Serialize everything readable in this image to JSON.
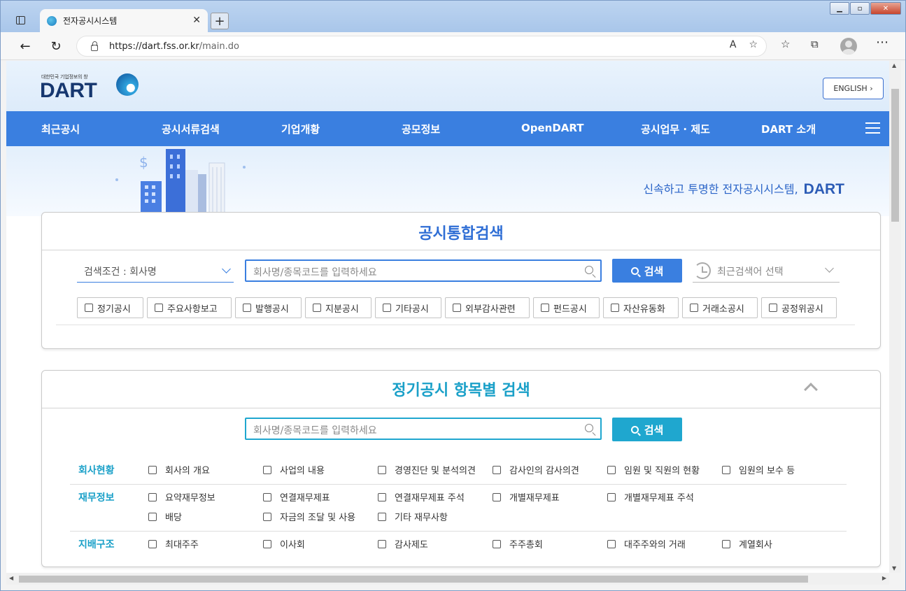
{
  "browser": {
    "tab_title": "전자공시시스템",
    "url_host": "https://dart.fss.or.kr",
    "url_path": "/main.do"
  },
  "header": {
    "logo_tagline": "대한민국 기업정보의 창",
    "logo_text": "DART",
    "english_button": "ENGLISH ›"
  },
  "gnb": [
    "최근공시",
    "공시서류검색",
    "기업개황",
    "공모정보",
    "OpenDART",
    "공시업무 · 제도",
    "DART 소개"
  ],
  "hero": {
    "slogan": "신속하고 투명한 전자공시시스템,",
    "slogan_brand": "DART"
  },
  "integrated_search": {
    "title": "공시통합검색",
    "condition": "검색조건 : 회사명",
    "placeholder": "회사명/종목코드를 입력하세요",
    "search_label": "검색",
    "recent_label": "최근검색어 선택",
    "filters": [
      "정기공시",
      "주요사항보고",
      "발행공시",
      "지분공시",
      "기타공시",
      "외부감사관련",
      "펀드공시",
      "자산유동화",
      "거래소공시",
      "공정위공시"
    ]
  },
  "periodic_search": {
    "title": "정기공시 항목별 검색",
    "placeholder": "회사명/종목코드를 입력하세요",
    "search_label": "검색",
    "categories": [
      {
        "name": "회사현황",
        "items": [
          "회사의 개요",
          "사업의 내용",
          "경영진단 및 분석의견",
          "감사인의 감사의견",
          "임원 및 직원의 현황",
          "임원의 보수 등"
        ]
      },
      {
        "name": "재무정보",
        "items": [
          "요약재무정보",
          "연결재무제표",
          "연결재무제표 주석",
          "개별재무제표",
          "개별재무제표 주석",
          "배당",
          "자금의 조달 및 사용",
          "기타 재무사항"
        ]
      },
      {
        "name": "지배구조",
        "items": [
          "최대주주",
          "이사회",
          "감사제도",
          "주주총회",
          "대주주와의 거래",
          "계열회사"
        ]
      }
    ]
  },
  "colors": {
    "primary": "#3a7fe0",
    "teal": "#1aa0c8",
    "teal_button": "#1fa7cf"
  }
}
